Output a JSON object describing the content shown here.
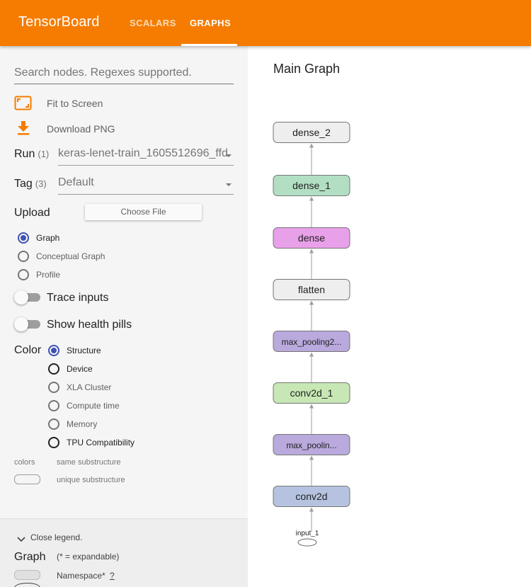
{
  "header": {
    "title": "TensorBoard",
    "tabs": [
      {
        "label": "SCALARS",
        "active": false
      },
      {
        "label": "GRAPHS",
        "active": true
      }
    ],
    "accent_color": "#f57c00"
  },
  "sidebar": {
    "search_placeholder": "Search nodes. Regexes supported.",
    "fit_to_screen": "Fit to Screen",
    "download_png": "Download PNG",
    "run": {
      "label": "Run",
      "count": "(1)",
      "value": "keras-lenet-train_1605512696_ffd"
    },
    "tag": {
      "label": "Tag",
      "count": "(3)",
      "value": "Default"
    },
    "upload": {
      "label": "Upload",
      "button": "Choose File"
    },
    "graph_types": [
      {
        "label": "Graph",
        "checked": true
      },
      {
        "label": "Conceptual Graph",
        "checked": false
      },
      {
        "label": "Profile",
        "checked": false
      }
    ],
    "toggles": [
      {
        "label": "Trace inputs",
        "on": false
      },
      {
        "label": "Show health pills",
        "on": false
      }
    ],
    "color": {
      "label": "Color",
      "options": [
        {
          "label": "Structure",
          "checked": true
        },
        {
          "label": "Device",
          "checked": false
        },
        {
          "label": "XLA Cluster",
          "checked": false
        },
        {
          "label": "Compute time",
          "checked": false
        },
        {
          "label": "Memory",
          "checked": false
        },
        {
          "label": "TPU Compatibility",
          "checked": false
        }
      ]
    },
    "colors_legend": {
      "label": "colors",
      "same": "same substructure",
      "unique": "unique substructure"
    },
    "legend": {
      "close": "Close legend.",
      "graph_label": "Graph",
      "expandable_note": "(* = expandable)",
      "namespace": "Namespace*",
      "namespace_help": "?"
    }
  },
  "main": {
    "title": "Main Graph",
    "nodes": [
      {
        "label": "dense_2",
        "fill": "#eeeeee"
      },
      {
        "label": "dense_1",
        "fill": "#b2dfc3"
      },
      {
        "label": "dense",
        "fill": "#e8a0e8"
      },
      {
        "label": "flatten",
        "fill": "#eeeeee"
      },
      {
        "label": "max_pooling2...",
        "fill": "#b9a9dc"
      },
      {
        "label": "conv2d_1",
        "fill": "#c7e7b4"
      },
      {
        "label": "max_poolin...",
        "fill": "#b9a9dc"
      },
      {
        "label": "conv2d",
        "fill": "#b6c3e0"
      }
    ],
    "input_label": "input_1"
  }
}
